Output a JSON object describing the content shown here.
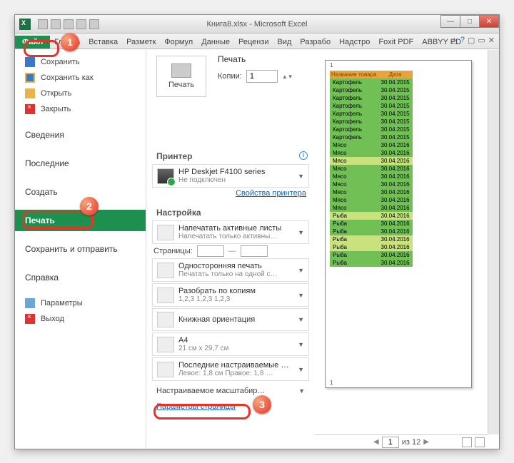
{
  "window": {
    "title": "Книга8.xlsx - Microsoft Excel"
  },
  "ribbon": {
    "file": "Файл",
    "tabs": [
      "Главна",
      "Вставка",
      "Разметк",
      "Формул",
      "Данные",
      "Рецензи",
      "Вид",
      "Разрабо",
      "Надстро",
      "Foxit PDF",
      "ABBYY PD"
    ]
  },
  "backstage": {
    "save": "Сохранить",
    "saveas": "Сохранить как",
    "open": "Открыть",
    "close": "Закрыть",
    "info": "Сведения",
    "recent": "Последние",
    "new": "Создать",
    "print": "Печать",
    "send": "Сохранить и отправить",
    "help": "Справка",
    "options": "Параметры",
    "exit": "Выход"
  },
  "print": {
    "header": "Печать",
    "button": "Печать",
    "copies_label": "Копии:",
    "copies_value": "1",
    "printer_section": "Принтер",
    "printer_name": "HP Deskjet F4100 series",
    "printer_status": "Не подключен",
    "printer_props": "Свойства принтера",
    "settings_section": "Настройка",
    "active_sheets": "Напечатать активные листы",
    "active_sheets_sub": "Напечатать только активны…",
    "pages_label": "Страницы:",
    "pages_dash": "—",
    "one_sided": "Односторонняя печать",
    "one_sided_sub": "Печатать только на одной с…",
    "collate": "Разобрать по копиям",
    "collate_sub": "1,2,3   1,2,3   1,2,3",
    "orientation": "Книжная ориентация",
    "paper": "A4",
    "paper_sub": "21 см x 29,7 см",
    "margins": "Последние настраиваемые …",
    "margins_sub": "Левое: 1,8 см   Правое: 1,8 …",
    "scaling": "Настраиваемое масштабир…",
    "page_setup": "Параметры страницы"
  },
  "preview": {
    "page_number": "1",
    "page_of": "из 12",
    "current": "1",
    "headers": [
      "Название товара",
      "Дата"
    ],
    "rows": [
      {
        "c": "g",
        "n": "Картофель",
        "d": "30.04.2015"
      },
      {
        "c": "g",
        "n": "Картофель",
        "d": "30.04.2015"
      },
      {
        "c": "g",
        "n": "Картофель",
        "d": "30.04.2015"
      },
      {
        "c": "g",
        "n": "Картофель",
        "d": "30.04.2015"
      },
      {
        "c": "g",
        "n": "Картофель",
        "d": "30.04.2015"
      },
      {
        "c": "g",
        "n": "Картофель",
        "d": "30.04.2015"
      },
      {
        "c": "g",
        "n": "Картофель",
        "d": "30.04.2015"
      },
      {
        "c": "g",
        "n": "Картофель",
        "d": "30.04.2015"
      },
      {
        "c": "g",
        "n": "Мясо",
        "d": "30.04.2016"
      },
      {
        "c": "g",
        "n": "Мясо",
        "d": "30.04.2016"
      },
      {
        "c": "y",
        "n": "Мясо",
        "d": "30.04.2016"
      },
      {
        "c": "g",
        "n": "Мясо",
        "d": "30.04.2016"
      },
      {
        "c": "g",
        "n": "Мясо",
        "d": "30.04.2016"
      },
      {
        "c": "g",
        "n": "Мясо",
        "d": "30.04.2016"
      },
      {
        "c": "g",
        "n": "Мясо",
        "d": "30.04.2016"
      },
      {
        "c": "g",
        "n": "Мясо",
        "d": "30.04.2016"
      },
      {
        "c": "g",
        "n": "Мясо",
        "d": "30.04.2016"
      },
      {
        "c": "y",
        "n": "Рыба",
        "d": "30.04.2016"
      },
      {
        "c": "g",
        "n": "Рыба",
        "d": "30.04.2016"
      },
      {
        "c": "g",
        "n": "Рыба",
        "d": "30.04.2016"
      },
      {
        "c": "y",
        "n": "Рыба",
        "d": "30.04.2016"
      },
      {
        "c": "y",
        "n": "Рыба",
        "d": "30.04.2016"
      },
      {
        "c": "g",
        "n": "Рыба",
        "d": "30.04.2016"
      },
      {
        "c": "g",
        "n": "Рыба",
        "d": "30.04.2016"
      }
    ]
  }
}
